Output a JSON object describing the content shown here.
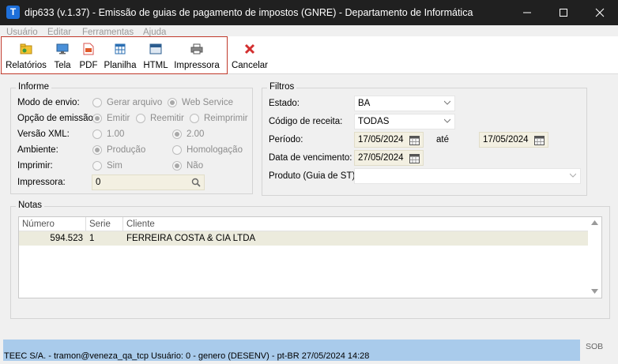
{
  "window": {
    "icon_letter": "T",
    "title": "dip633 (v.1.37) - Emissão de guias de pagamento de impostos (GNRE) - Departamento de Informática"
  },
  "menu": [
    "Usuário",
    "Editar",
    "Ferramentas",
    "Ajuda"
  ],
  "toolbar": {
    "buttons": [
      {
        "label": "Relatórios",
        "icon": "reports-icon"
      },
      {
        "label": "Tela",
        "icon": "screen-icon"
      },
      {
        "label": "PDF",
        "icon": "pdf-icon"
      },
      {
        "label": "Planilha",
        "icon": "spreadsheet-icon"
      },
      {
        "label": "HTML",
        "icon": "html-icon"
      },
      {
        "label": "Impressora",
        "icon": "printer-icon"
      },
      {
        "label": "Cancelar",
        "icon": "cancel-icon"
      }
    ],
    "highlight_color": "#c0392b"
  },
  "informe": {
    "title": "Informe",
    "modo_envio": {
      "label": "Modo de envio:",
      "options": [
        "Gerar arquivo",
        "Web Service"
      ],
      "selected": "Web Service"
    },
    "opcao_emissao": {
      "label": "Opção de emissão:",
      "options": [
        "Emitir",
        "Reemitir",
        "Reimprimir"
      ],
      "selected": "Emitir"
    },
    "versao_xml": {
      "label": "Versão XML:",
      "options": [
        "1.00",
        "2.00"
      ],
      "selected": "2.00"
    },
    "ambiente": {
      "label": "Ambiente:",
      "options": [
        "Produção",
        "Homologação"
      ],
      "selected": "Produção"
    },
    "imprimir": {
      "label": "Imprimir:",
      "options": [
        "Sim",
        "Não"
      ],
      "selected": "Não"
    },
    "impressora": {
      "label": "Impressora:",
      "value": "0"
    }
  },
  "filtros": {
    "title": "Filtros",
    "estado": {
      "label": "Estado:",
      "value": "BA"
    },
    "codigo_receita": {
      "label": "Código de receita:",
      "value": "TODAS"
    },
    "periodo": {
      "label": "Período:",
      "from": "17/05/2024",
      "separator": "até",
      "to": "17/05/2024"
    },
    "data_vencimento": {
      "label": "Data de vencimento:",
      "value": "27/05/2024"
    },
    "produto": {
      "label": "Produto (Guia de ST):",
      "value": ""
    }
  },
  "notas": {
    "title": "Notas",
    "columns": [
      "Número",
      "Serie",
      "Cliente"
    ],
    "rows": [
      {
        "numero": "594.523",
        "serie": "1",
        "cliente": "FERREIRA COSTA & CIA LTDA"
      }
    ]
  },
  "status": {
    "text": "TEEC S/A. - tramon@veneza_qa_tcp    Usuário: 0 - genero (DESENV) - pt-BR    27/05/2024 14:28",
    "side": "SOB",
    "color": "#a9cbeb"
  }
}
